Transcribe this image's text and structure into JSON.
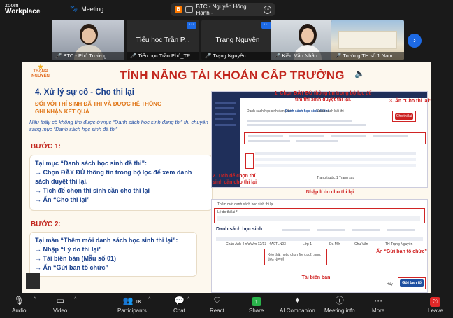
{
  "app": {
    "brand_small": "zoom",
    "brand": "Workplace",
    "meeting_label": "Meeting"
  },
  "share": {
    "badge": "B",
    "title": "BTC - Nguyễn Hồng Hạnh -",
    "more": "···"
  },
  "gallery": {
    "tiles": [
      {
        "name": "BTC - Phó Trưởng ...",
        "has_video": true,
        "muted": true
      },
      {
        "name": "Tiểu học Trần Phú_TP ...",
        "big_name": "Tiểu học Trần P...",
        "has_video": false,
        "muted": true,
        "menu": "···"
      },
      {
        "name": "Trạng Nguyên",
        "big_name": "Trạng Nguyên",
        "has_video": false,
        "muted": true,
        "menu": "···"
      },
      {
        "name": "Kiều Văn Nhân",
        "has_video": true,
        "muted": true
      },
      {
        "name": "Trường TH số 1 Nam...",
        "has_video": true,
        "muted": true
      }
    ],
    "next_arrow": "›"
  },
  "slide": {
    "logo_line1": "TRẠNG",
    "logo_line2": "NGUYÊN",
    "title": "TÍNH NĂNG TÀI KHOẢN CẤP TRƯỜNG",
    "section": "4. Xử lý sự cố - Cho thi lại",
    "subtitle1": "ĐỐI VỚI THÍ SINH ĐÃ THI VÀ ĐƯỢC HỆ THỐNG",
    "subtitle2": "GHI NHẬN KẾT QUẢ",
    "intro": "Nếu thấy cố không tìm được ở mục “Danh sách học sinh đang thi” thì chuyển sang mục “Danh sách học sinh đã thi”",
    "step1": "BƯỚC 1:",
    "step1_lines": [
      "Tại mục “Danh sách học sinh đã thi”:",
      "→ Chọn ĐẦY ĐỦ thông tin trong bộ lọc để xem danh sách duyệt thi lại.",
      "→ Tích để chọn thí sinh cần cho thi lại",
      "→ Ấn “Cho thi lại”"
    ],
    "step2": "BƯỚC 2:",
    "step2_lines": [
      "Tại màn “Thêm mới danh sách học sinh thi lại”:",
      "→ Nhập “Lý do thi lại”",
      "→ Tải biên bản (Mẫu số 01)",
      "→ Ấn “Gửi ban tổ chức”"
    ],
    "callouts": {
      "c1": "1. Chọn ĐẦY ĐỦ thông tin trong bộ lọc để tìm thí sinh duyệt thi lại.",
      "c2": "2. Tích để chọn thí sinh cần cho thi lại",
      "c3": "3. Ấn “Cho thi lại”",
      "reason": "Nhập lí do cho thi lại",
      "upload": "Tải biên bản",
      "send": "Ấn “Gửi ban tổ chức”"
    },
    "shot1": {
      "tab1": "Danh sách học sinh đang thi",
      "tab2": "Danh sách học sinh đã thi",
      "tab3": "Danh sách bài thi",
      "retest_btn": "Cho thi lại",
      "footer": "Trang trước  1  Trang sau"
    },
    "shot2": {
      "modal_title": "Thêm mới danh sách học sinh thi lại",
      "reason_label": "Lý do thi lại *",
      "list_title": "Danh sách học sinh",
      "row_name": "Châu Anh 4 n/a/a/m 12/13",
      "row_class": "4A0TLN03",
      "row_grade": "Lớp 1",
      "row_school": "Đa Mở",
      "row_district": "Chu Văn",
      "row_unit": "TH Trạng Nguyên",
      "upload_box": "Kéo thả, hoặc chọn file (.pdf, .png, .jpg, .jpeg)",
      "cancel": "Hủy",
      "send": "Gửi ban tổ chức"
    }
  },
  "toolbar": {
    "items": [
      {
        "label": "Audio"
      },
      {
        "label": "Video"
      },
      {
        "label": "Participants",
        "badge": "1K"
      },
      {
        "label": "Chat"
      },
      {
        "label": "React"
      },
      {
        "label": "Share"
      },
      {
        "label": "AI Companion"
      },
      {
        "label": "Meeting info"
      },
      {
        "label": "More"
      },
      {
        "label": "Leave"
      }
    ]
  }
}
